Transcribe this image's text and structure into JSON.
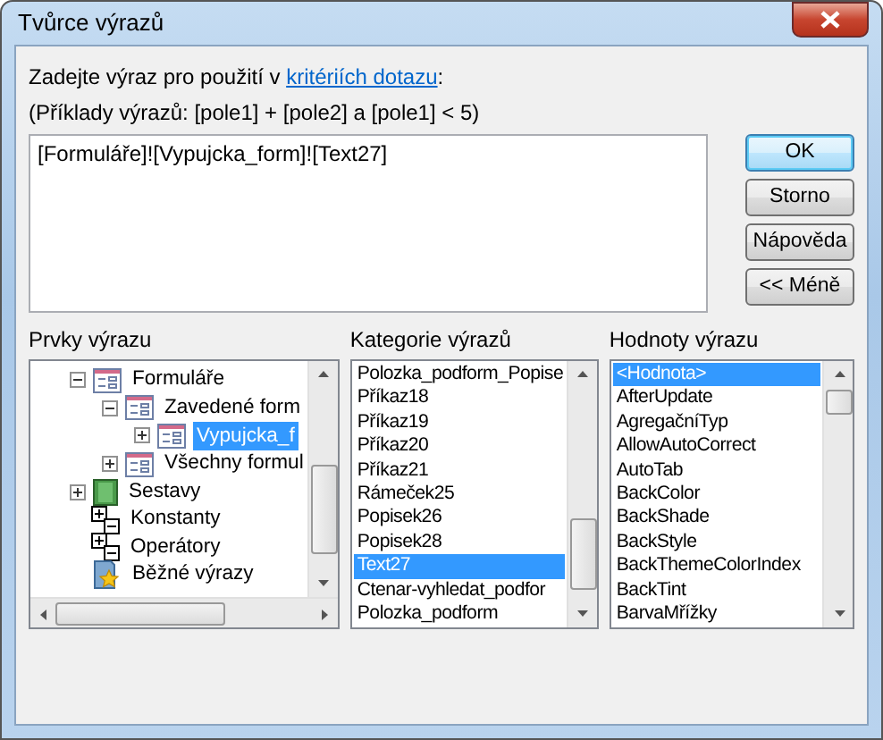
{
  "window": {
    "title": "Tvůrce výrazů"
  },
  "instruction": {
    "text": "Zadejte výraz pro použití v ",
    "link": "kritériích dotazu",
    "suffix": ":"
  },
  "example": "(Příklady výrazů: [pole1] + [pole2] a [pole1] < 5)",
  "expression": "[Formuláře]![Vypujcka_form]![Text27]",
  "buttons": [
    {
      "label": "OK",
      "default": true
    },
    {
      "label": "Storno",
      "default": false
    },
    {
      "label": "Nápověda",
      "default": false
    },
    {
      "label": "<< Méně",
      "default": false
    }
  ],
  "elements": {
    "label": "Prvky výrazu",
    "items": [
      {
        "label": "Formuláře",
        "kind": "form",
        "expanded": true,
        "selected": false,
        "children": [
          {
            "label": "Zavedené form",
            "kind": "form",
            "expanded": true,
            "selected": false,
            "children": [
              {
                "label": "Vypujcka_f",
                "kind": "form",
                "expanded": false,
                "selected": true
              }
            ]
          },
          {
            "label": "Všechny formul",
            "kind": "form",
            "expanded": false,
            "selected": false
          }
        ]
      },
      {
        "label": "Sestavy",
        "kind": "report",
        "expanded": false,
        "selected": false
      },
      {
        "label": "Konstanty",
        "kind": "constants",
        "selected": false
      },
      {
        "label": "Operátory",
        "kind": "operators",
        "selected": false
      },
      {
        "label": "Běžné výrazy",
        "kind": "common",
        "selected": false
      }
    ]
  },
  "categories": {
    "label": "Kategorie výrazů",
    "items": [
      {
        "label": "Polozka_podform_Popise",
        "selected": false
      },
      {
        "label": "Příkaz18",
        "selected": false
      },
      {
        "label": "Příkaz19",
        "selected": false
      },
      {
        "label": "Příkaz20",
        "selected": false
      },
      {
        "label": "Příkaz21",
        "selected": false
      },
      {
        "label": "Rámeček25",
        "selected": false
      },
      {
        "label": "Popisek26",
        "selected": false
      },
      {
        "label": "Popisek28",
        "selected": false
      },
      {
        "label": "Text27",
        "selected": true
      },
      {
        "label": "Ctenar-vyhledat_podfor",
        "selected": false
      },
      {
        "label": "Polozka_podform",
        "selected": false
      }
    ]
  },
  "values": {
    "label": "Hodnoty výrazu",
    "items": [
      {
        "label": "<Hodnota>",
        "selected": true
      },
      {
        "label": "AfterUpdate",
        "selected": false
      },
      {
        "label": "AgregačníTyp",
        "selected": false
      },
      {
        "label": "AllowAutoCorrect",
        "selected": false
      },
      {
        "label": "AutoTab",
        "selected": false
      },
      {
        "label": "BackColor",
        "selected": false
      },
      {
        "label": "BackShade",
        "selected": false
      },
      {
        "label": "BackStyle",
        "selected": false
      },
      {
        "label": "BackThemeColorIndex",
        "selected": false
      },
      {
        "label": "BackTint",
        "selected": false
      },
      {
        "label": "BarvaMřížky",
        "selected": false
      }
    ]
  }
}
